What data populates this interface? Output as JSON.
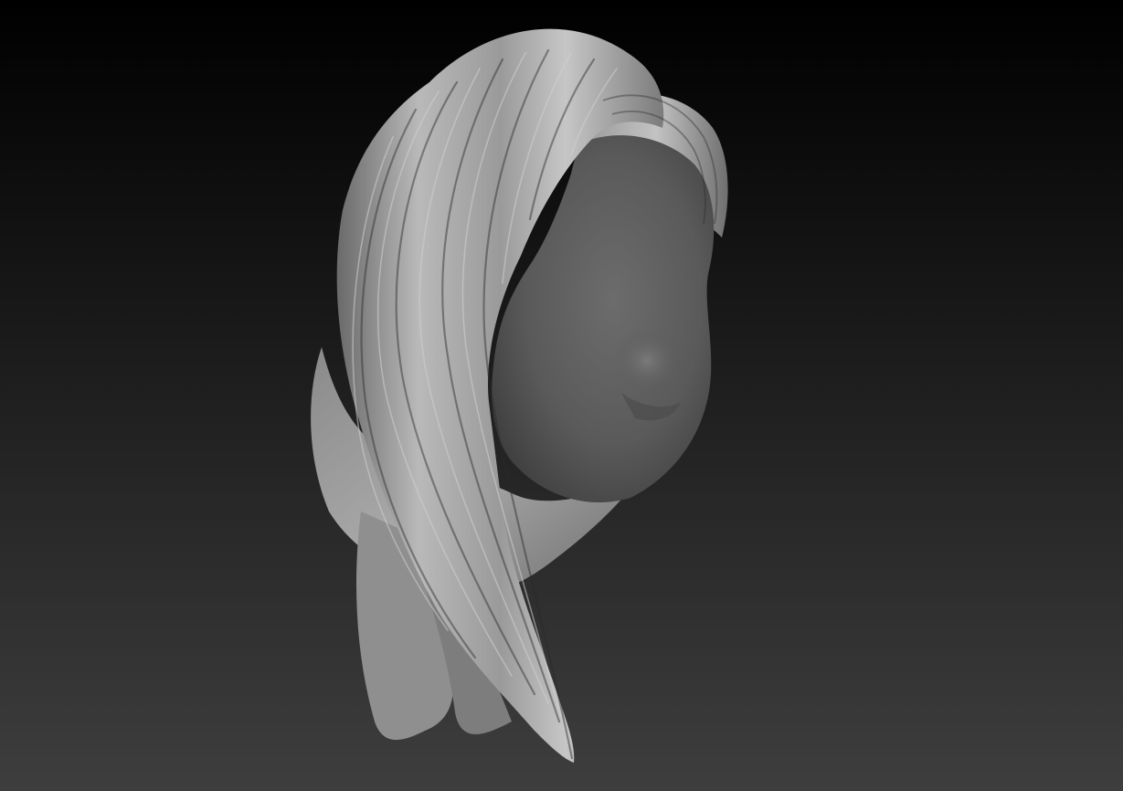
{
  "viewport": {
    "background_top": "#000000",
    "background_bottom": "#3e3e3e"
  },
  "model": {
    "name": "sculpted-hair-and-face-mask",
    "material_color": "#8a8a8a",
    "highlight_color": "#d0d0d0",
    "shadow_color": "#2a2a2a"
  }
}
